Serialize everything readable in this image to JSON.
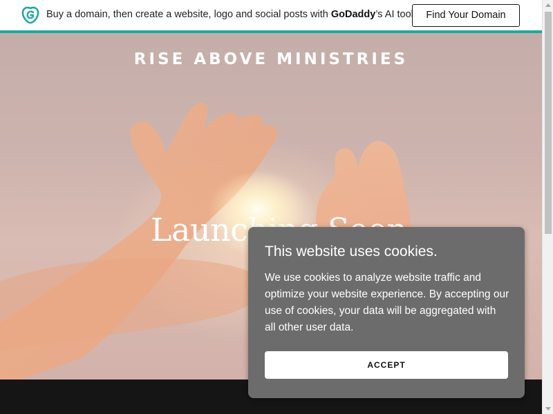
{
  "promo_bar": {
    "text_before": "Buy a domain, then create a website, logo and social posts with ",
    "brand": "GoDaddy",
    "text_after": "’s AI tools.",
    "button_label": "Find Your Domain"
  },
  "hero": {
    "site_title": "RISE ABOVE MINISTRIES",
    "headline": "Launching Soon"
  },
  "cookie_dialog": {
    "title": "This website uses cookies.",
    "body": "We use cookies to analyze website traffic and optimize your website experience. By accepting our use of cookies, your data will be aggregated with all other user data.",
    "accept_label": "ACCEPT"
  },
  "colors": {
    "promo_accent": "#1ea7a1",
    "dialog_background": "#6c6c6c",
    "footer_band": "#151515"
  },
  "icons": {
    "promo_logo": "godaddy-logo-icon"
  }
}
